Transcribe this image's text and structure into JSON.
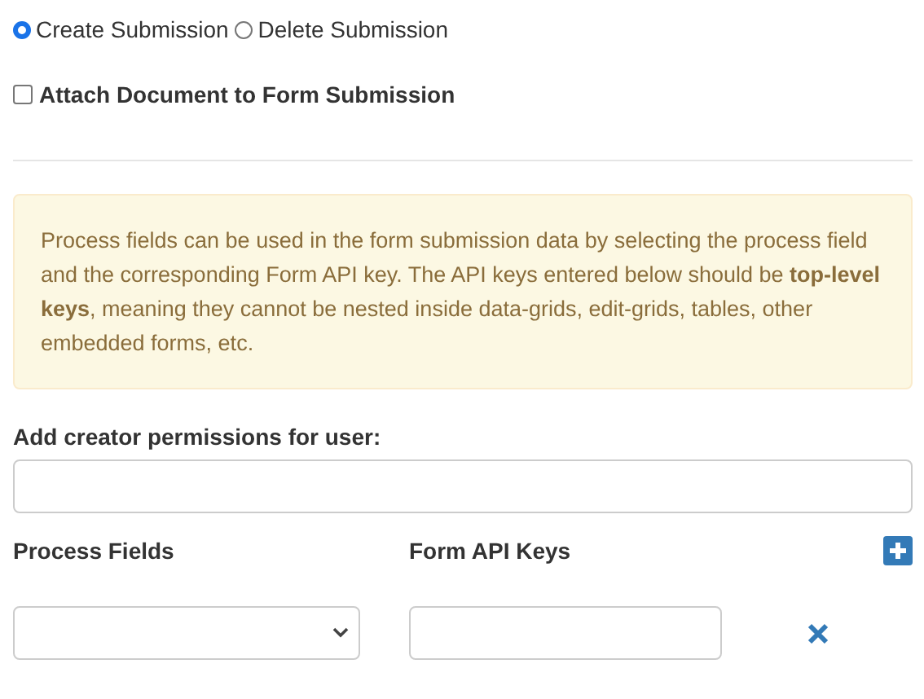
{
  "radios": [
    {
      "label": "Create Submission",
      "selected": true
    },
    {
      "label": "Delete Submission",
      "selected": false
    }
  ],
  "attach": {
    "label": "Attach Document to Form Submission",
    "checked": false
  },
  "notice": "Process fields can be used in the form submission data by selecting the process field and the corresponding Form API key. The API keys entered below should be **top-level keys**, meaning they cannot be nested inside data-grids, edit-grids, tables, other embedded forms, etc.",
  "creator": {
    "label": "Add creator permissions for user:"
  },
  "mapping": {
    "columns": [
      "Process Fields",
      "Form API Keys"
    ]
  }
}
